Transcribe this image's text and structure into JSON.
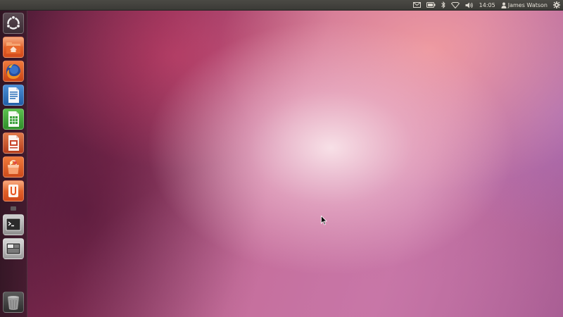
{
  "top_panel": {
    "indicators": [
      {
        "icon": "mail-icon"
      },
      {
        "icon": "battery-icon"
      },
      {
        "icon": "bluetooth-icon"
      },
      {
        "icon": "wifi-icon"
      },
      {
        "icon": "volume-icon"
      }
    ],
    "clock": "14:05",
    "user_name": "James Watson",
    "session_icon": "gear-icon"
  },
  "launcher": {
    "items": [
      {
        "name": "dash-home",
        "icon": "ubuntu-logo-icon"
      },
      {
        "name": "home-folder",
        "icon": "home-folder-icon"
      },
      {
        "name": "firefox",
        "icon": "firefox-icon"
      },
      {
        "name": "libreoffice-writer",
        "icon": "writer-document-icon"
      },
      {
        "name": "libreoffice-calc",
        "icon": "calc-spreadsheet-icon"
      },
      {
        "name": "libreoffice-impress",
        "icon": "impress-presentation-icon"
      },
      {
        "name": "software-center",
        "icon": "shopping-bag-icon"
      },
      {
        "name": "ubuntu-one",
        "icon": "ubuntu-one-icon"
      },
      {
        "name": "terminal",
        "icon": "terminal-icon"
      },
      {
        "name": "workspace-switcher",
        "icon": "workspace-switcher-icon"
      },
      {
        "name": "trash",
        "icon": "trash-icon"
      }
    ]
  },
  "colors": {
    "panel_bg": "#3c3b37",
    "launcher_bg": "#2e1a24",
    "ubuntu_orange": "#e9541f",
    "firefox_blue": "#2a4d9c",
    "writer_blue": "#2a6fb8",
    "calc_green": "#3aa13a",
    "impress_red": "#c8452a"
  }
}
